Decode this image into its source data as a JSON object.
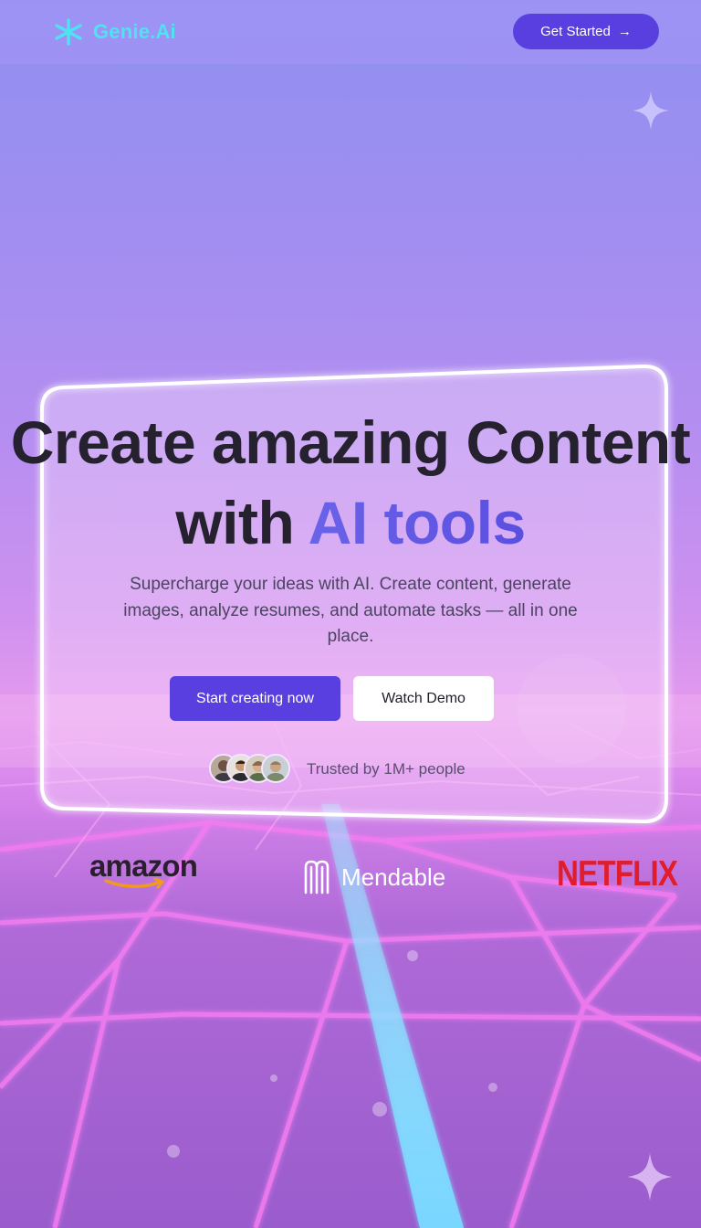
{
  "colors": {
    "brand": "#4fe3f0",
    "primary": "#5a3fe0",
    "headline": "#25212e",
    "accent_gradient": [
      "#6a62e8",
      "#5a4fe0"
    ],
    "netflix": "#e11d2c"
  },
  "nav": {
    "brand_icon": "sparkle-flower-icon",
    "brand_name": "Genie.Ai",
    "cta_label": "Get Started",
    "cta_icon": "arrow-right-icon"
  },
  "hero": {
    "headline_line1": "Create amazing Content",
    "headline_line2_plain": "with ",
    "headline_line2_accent": "AI tools",
    "subtext": "Supercharge your ideas with AI. Create content, generate images, analyze resumes, and automate tasks — all in one place.",
    "primary_button": "Start creating now",
    "secondary_button": "Watch Demo",
    "trust_text": "Trusted by 1M+ people"
  },
  "logos": {
    "amazon": "amazon",
    "mendable": "Mendable",
    "netflix": "NETFLIX"
  }
}
